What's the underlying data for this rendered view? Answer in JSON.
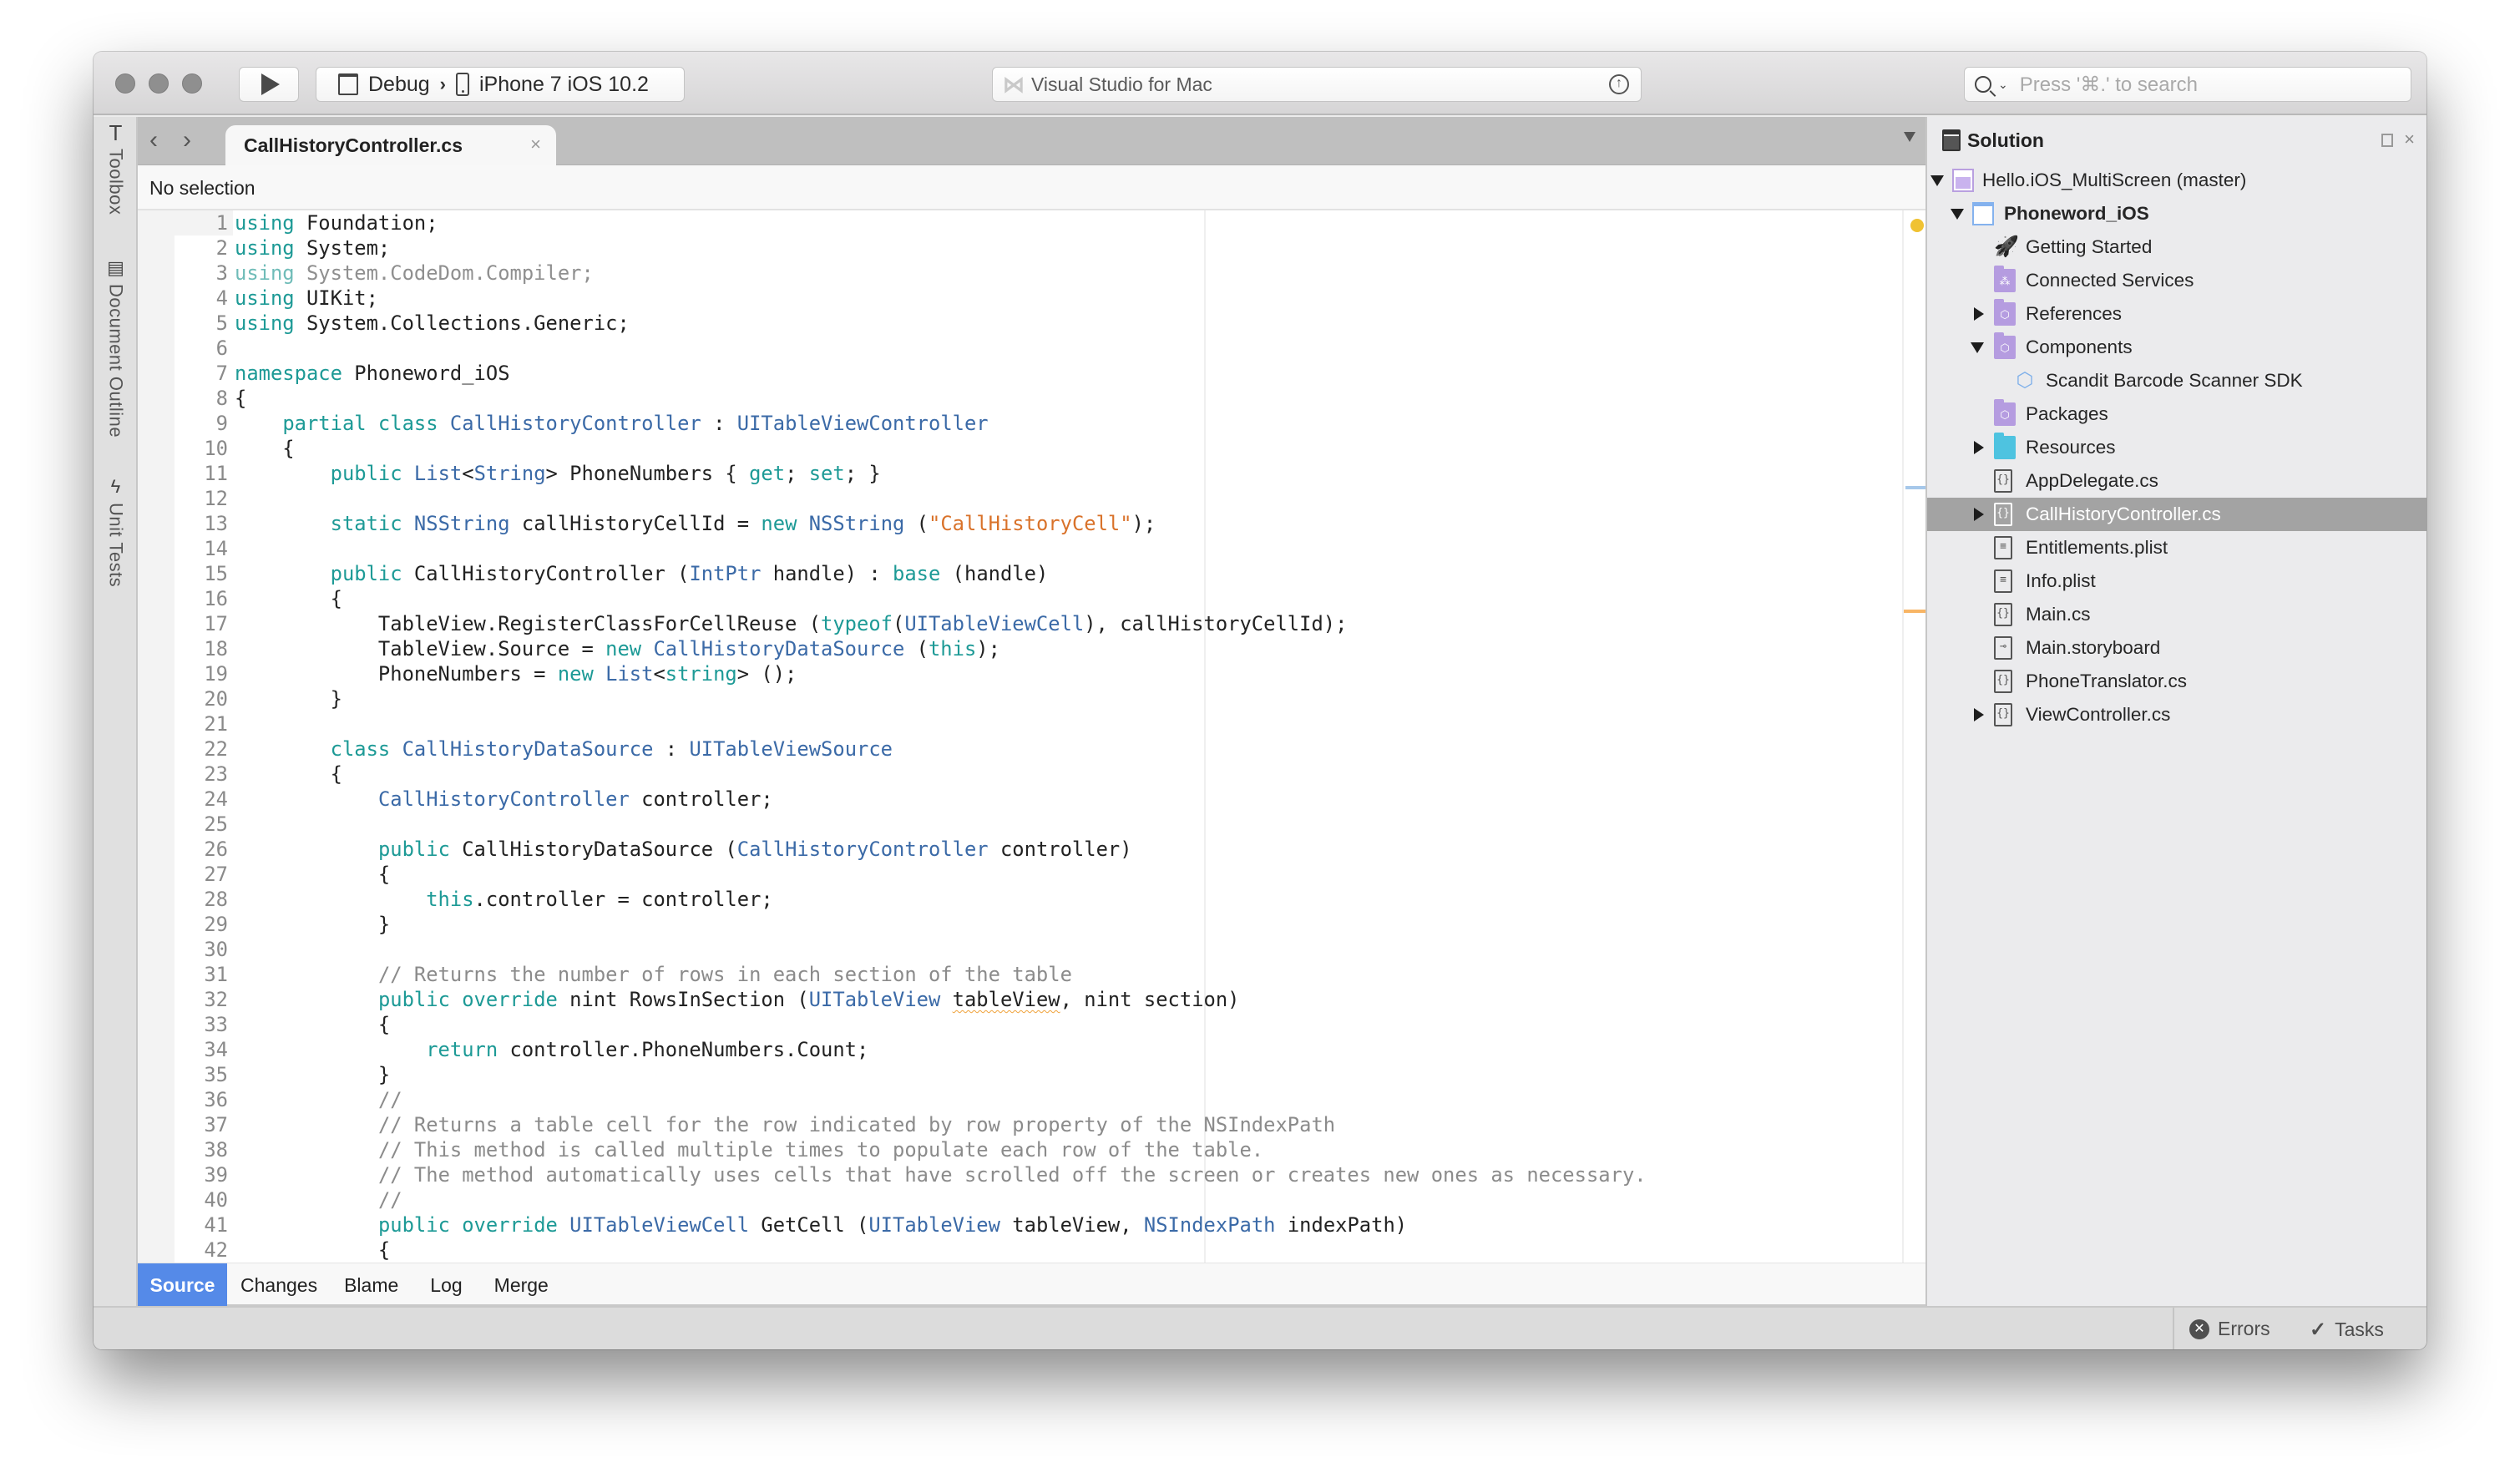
{
  "titlebar": {
    "config": "Debug",
    "device": "iPhone 7 iOS 10.2",
    "status_text": "Visual Studio for Mac",
    "search_placeholder": "Press '⌘.' to search"
  },
  "left_strip": {
    "tabs": [
      {
        "label": "Toolbox",
        "icon": "hammer-icon"
      },
      {
        "label": "Document Outline",
        "icon": "outline-icon"
      },
      {
        "label": "Unit Tests",
        "icon": "bolt-icon"
      }
    ]
  },
  "editor": {
    "tab_label": "CallHistoryController.cs",
    "close_glyph": "×",
    "path_text": "No selection",
    "bottom_tabs": [
      "Source",
      "Changes",
      "Blame",
      "Log",
      "Merge"
    ],
    "active_bottom_tab": "Source",
    "code_lines": [
      [
        [
          "kw",
          "using"
        ],
        [
          "",
          "  Foundation;"
        ]
      ],
      [
        [
          "kw",
          "using"
        ],
        [
          "",
          "  System;"
        ]
      ],
      [
        [
          "dimkw",
          "using"
        ],
        [
          "dim",
          "  System.CodeDom.Compiler;"
        ]
      ],
      [
        [
          "kw",
          "using"
        ],
        [
          "",
          "  UIKit;"
        ]
      ],
      [
        [
          "kw",
          "using"
        ],
        [
          "",
          "  System.Collections.Generic;"
        ]
      ],
      [],
      [
        [
          "kw",
          "namespace"
        ],
        [
          "",
          "  Phoneword_iOS"
        ]
      ],
      [
        [
          "",
          "{"
        ]
      ],
      [
        [
          "",
          "    "
        ],
        [
          "kw",
          "partial class"
        ],
        [
          "",
          " "
        ],
        [
          "ty",
          "CallHistoryController"
        ],
        [
          "",
          " : "
        ],
        [
          "ty",
          "UITableViewController"
        ]
      ],
      [
        [
          "",
          "    {"
        ]
      ],
      [
        [
          "",
          "        "
        ],
        [
          "kw",
          "public"
        ],
        [
          "",
          " "
        ],
        [
          "ty",
          "List"
        ],
        [
          "",
          "<"
        ],
        [
          "ty",
          "String"
        ],
        [
          "",
          "> PhoneNumbers { "
        ],
        [
          "kw",
          "get"
        ],
        [
          "",
          "; "
        ],
        [
          "kw",
          "set"
        ],
        [
          "",
          "; }"
        ]
      ],
      [],
      [
        [
          "",
          "        "
        ],
        [
          "kw",
          "static"
        ],
        [
          "",
          " "
        ],
        [
          "ty",
          "NSString"
        ],
        [
          "",
          " callHistoryCellId = "
        ],
        [
          "kw",
          "new"
        ],
        [
          "",
          " "
        ],
        [
          "ty",
          "NSString"
        ],
        [
          "",
          " ("
        ],
        [
          "str",
          "\"CallHistoryCell\""
        ],
        [
          "",
          ");"
        ]
      ],
      [],
      [
        [
          "",
          "        "
        ],
        [
          "kw",
          "public"
        ],
        [
          "",
          " CallHistoryController ("
        ],
        [
          "ty",
          "IntPtr"
        ],
        [
          "",
          " handle) : "
        ],
        [
          "kw",
          "base"
        ],
        [
          "",
          " (handle)"
        ]
      ],
      [
        [
          "",
          "        {"
        ]
      ],
      [
        [
          "",
          "            TableView.RegisterClassForCellReuse ("
        ],
        [
          "kw",
          "typeof"
        ],
        [
          "",
          "("
        ],
        [
          "ty",
          "UITableViewCell"
        ],
        [
          "",
          "), callHistoryCellId);"
        ]
      ],
      [
        [
          "",
          "            TableView.Source = "
        ],
        [
          "kw",
          "new"
        ],
        [
          "",
          " "
        ],
        [
          "ty",
          "CallHistoryDataSource"
        ],
        [
          "",
          " ("
        ],
        [
          "kw",
          "this"
        ],
        [
          "",
          ");"
        ]
      ],
      [
        [
          "",
          "            PhoneNumbers = "
        ],
        [
          "kw",
          "new"
        ],
        [
          "",
          " "
        ],
        [
          "ty",
          "List"
        ],
        [
          "",
          "<"
        ],
        [
          "kw",
          "string"
        ],
        [
          "",
          "> ();"
        ]
      ],
      [
        [
          "",
          "        }"
        ]
      ],
      [],
      [
        [
          "",
          "        "
        ],
        [
          "kw",
          "class"
        ],
        [
          "",
          " "
        ],
        [
          "ty",
          "CallHistoryDataSource"
        ],
        [
          "",
          " : "
        ],
        [
          "ty",
          "UITableViewSource"
        ]
      ],
      [
        [
          "",
          "        {"
        ]
      ],
      [
        [
          "",
          "            "
        ],
        [
          "ty",
          "CallHistoryController"
        ],
        [
          "",
          " controller;"
        ]
      ],
      [],
      [
        [
          "",
          "            "
        ],
        [
          "kw",
          "public"
        ],
        [
          "",
          " CallHistoryDataSource ("
        ],
        [
          "ty",
          "CallHistoryController"
        ],
        [
          "",
          " controller)"
        ]
      ],
      [
        [
          "",
          "            {"
        ]
      ],
      [
        [
          "",
          "                "
        ],
        [
          "kw",
          "this"
        ],
        [
          "",
          ".controller = controller;"
        ]
      ],
      [
        [
          "",
          "            }"
        ]
      ],
      [],
      [
        [
          "",
          "            "
        ],
        [
          "cm",
          "// Returns the number of rows in each section of the table"
        ]
      ],
      [
        [
          "",
          "            "
        ],
        [
          "kw",
          "public override"
        ],
        [
          "",
          " nint RowsInSection ("
        ],
        [
          "ty",
          "UITableView"
        ],
        [
          "",
          " "
        ],
        [
          "squiggle",
          "tableView"
        ],
        [
          "",
          ", nint section)"
        ]
      ],
      [
        [
          "",
          "            {"
        ]
      ],
      [
        [
          "",
          "                "
        ],
        [
          "kw",
          "return"
        ],
        [
          "",
          " controller.PhoneNumbers.Count;"
        ]
      ],
      [
        [
          "",
          "            }"
        ]
      ],
      [
        [
          "",
          "            "
        ],
        [
          "cm",
          "//"
        ]
      ],
      [
        [
          "",
          "            "
        ],
        [
          "cm",
          "// Returns a table cell for the row indicated by row property of the NSIndexPath"
        ]
      ],
      [
        [
          "",
          "            "
        ],
        [
          "cm",
          "// This method is called multiple times to populate each row of the table."
        ]
      ],
      [
        [
          "",
          "            "
        ],
        [
          "cm",
          "// The method automatically uses cells that have scrolled off the screen or creates new ones as necessary."
        ]
      ],
      [
        [
          "",
          "            "
        ],
        [
          "cm",
          "//"
        ]
      ],
      [
        [
          "",
          "            "
        ],
        [
          "kw",
          "public override"
        ],
        [
          "",
          " "
        ],
        [
          "ty",
          "UITableViewCell"
        ],
        [
          "",
          " GetCell ("
        ],
        [
          "ty",
          "UITableView"
        ],
        [
          "",
          " tableView, "
        ],
        [
          "ty",
          "NSIndexPath"
        ],
        [
          "",
          " indexPath)"
        ]
      ],
      [
        [
          "",
          "            {"
        ]
      ]
    ]
  },
  "solution": {
    "title": "Solution",
    "close_glyph": "×",
    "items": [
      {
        "label": "Hello.iOS_MultiScreen (master)",
        "depth": 0,
        "expand": "open",
        "icon": "solution",
        "bold": false
      },
      {
        "label": "Phoneword_iOS",
        "depth": 1,
        "expand": "open",
        "icon": "project",
        "bold": true
      },
      {
        "label": "Getting Started",
        "depth": 2,
        "expand": "none",
        "icon": "rocket",
        "bold": false
      },
      {
        "label": "Connected Services",
        "depth": 2,
        "expand": "none",
        "icon": "folder-services",
        "bold": false
      },
      {
        "label": "References",
        "depth": 2,
        "expand": "closed",
        "icon": "folder-purple",
        "bold": false
      },
      {
        "label": "Components",
        "depth": 2,
        "expand": "open",
        "icon": "folder-purple",
        "bold": false
      },
      {
        "label": "Scandit Barcode Scanner SDK",
        "depth": 3,
        "expand": "none",
        "icon": "component",
        "bold": false
      },
      {
        "label": "Packages",
        "depth": 2,
        "expand": "none",
        "icon": "folder-purple",
        "bold": false
      },
      {
        "label": "Resources",
        "depth": 2,
        "expand": "closed",
        "icon": "folder-blue",
        "bold": false
      },
      {
        "label": "AppDelegate.cs",
        "depth": 2,
        "expand": "none",
        "icon": "cs-file",
        "bold": false
      },
      {
        "label": "CallHistoryController.cs",
        "depth": 2,
        "expand": "closed",
        "icon": "cs-file",
        "bold": false,
        "selected": true
      },
      {
        "label": "Entitlements.plist",
        "depth": 2,
        "expand": "none",
        "icon": "plist-file",
        "bold": false
      },
      {
        "label": "Info.plist",
        "depth": 2,
        "expand": "none",
        "icon": "plist-file",
        "bold": false
      },
      {
        "label": "Main.cs",
        "depth": 2,
        "expand": "none",
        "icon": "cs-file",
        "bold": false
      },
      {
        "label": "Main.storyboard",
        "depth": 2,
        "expand": "none",
        "icon": "storyboard-file",
        "bold": false
      },
      {
        "label": "PhoneTranslator.cs",
        "depth": 2,
        "expand": "none",
        "icon": "cs-file",
        "bold": false
      },
      {
        "label": "ViewController.cs",
        "depth": 2,
        "expand": "closed",
        "icon": "cs-file",
        "bold": false
      }
    ]
  },
  "statusbar": {
    "errors_label": "Errors",
    "tasks_label": "Tasks"
  },
  "colors": {
    "keyword": "#1d9a96",
    "type": "#3b6aa7",
    "string": "#d9722a",
    "comment": "#8b8b8b",
    "accent": "#558ae8",
    "selection": "#a3a3a3"
  }
}
